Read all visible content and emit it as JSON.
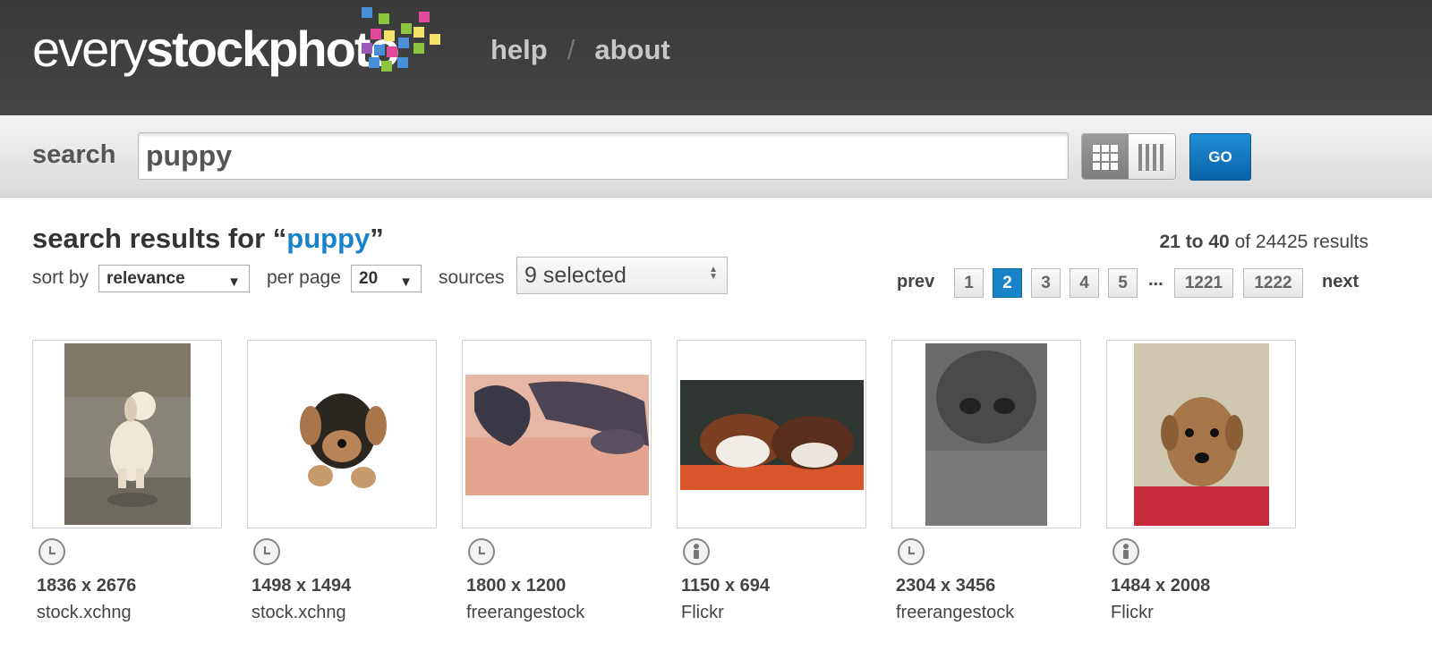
{
  "header": {
    "logo_light": "every",
    "logo_bold": "stockphoto",
    "nav": [
      {
        "label": "help"
      },
      {
        "label": "about"
      }
    ],
    "nav_separator": "/"
  },
  "search": {
    "label": "search",
    "value": "puppy",
    "go_label": "GO"
  },
  "results": {
    "heading_prefix": "search results for “",
    "query": "puppy",
    "heading_suffix": "”",
    "range": "21 to 40",
    "count_suffix": "of 24425 results"
  },
  "controls": {
    "sort_label": "sort by",
    "sort_value": "relevance",
    "per_page_label": "per page",
    "per_page_value": "20",
    "sources_label": "sources",
    "sources_value": "9 selected"
  },
  "pager": {
    "prev": "prev",
    "next": "next",
    "pages": [
      "1",
      "2",
      "3",
      "4",
      "5"
    ],
    "ellipsis": "...",
    "last_pages": [
      "1221",
      "1222"
    ],
    "current": "2"
  },
  "colors": {
    "accent": "#1883c9",
    "header_bg": "#3f3f3f",
    "go_button": "#0a63a8"
  },
  "items": [
    {
      "dims": "1836 x 2676",
      "source": "stock.xchng",
      "license_icon": "clock-license-icon"
    },
    {
      "dims": "1498 x 1494",
      "source": "stock.xchng",
      "license_icon": "clock-license-icon"
    },
    {
      "dims": "1800 x 1200",
      "source": "freerangestock",
      "license_icon": "clock-license-icon"
    },
    {
      "dims": "1150 x 694",
      "source": "Flickr",
      "license_icon": "person-license-icon"
    },
    {
      "dims": "2304 x 3456",
      "source": "freerangestock",
      "license_icon": "clock-license-icon"
    },
    {
      "dims": "1484 x 2008",
      "source": "Flickr",
      "license_icon": "person-license-icon"
    }
  ]
}
